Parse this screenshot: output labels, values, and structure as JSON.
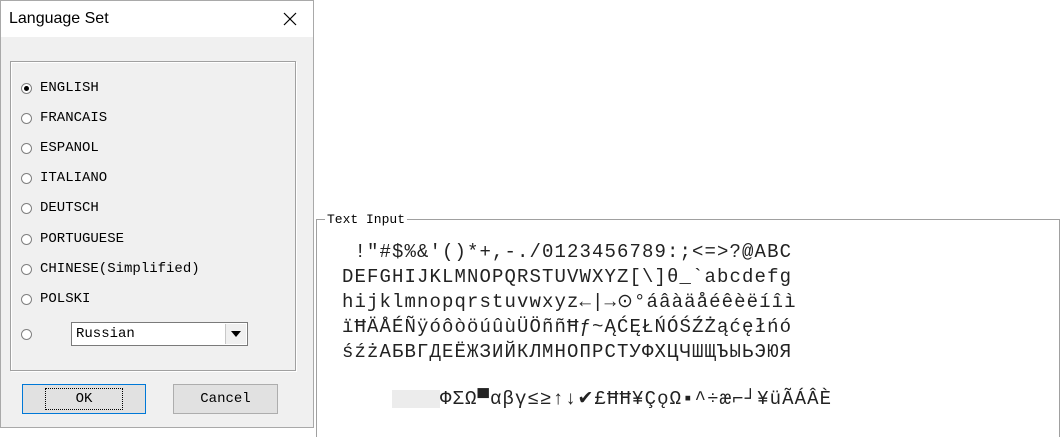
{
  "dialog": {
    "title": "Language Set",
    "languages": [
      {
        "label": "ENGLISH",
        "checked": true
      },
      {
        "label": "FRANCAIS",
        "checked": false
      },
      {
        "label": "ESPANOL",
        "checked": false
      },
      {
        "label": "ITALIANO",
        "checked": false
      },
      {
        "label": "DEUTSCH",
        "checked": false
      },
      {
        "label": "PORTUGUESE",
        "checked": false
      },
      {
        "label": "CHINESE(Simplified)",
        "checked": false
      },
      {
        "label": "POLSKI",
        "checked": false
      }
    ],
    "extra_language_value": "Russian",
    "ok_label": "OK",
    "cancel_label": "Cancel"
  },
  "text_input": {
    "legend": "Text Input",
    "rows": [
      " !\"#$%&'()*+,-./0123456789:;<=>?@ABC",
      "DEFGHIJKLMNOPQRSTUVWXYZ[\\]θ_`abcdefg",
      "hijklmnopqrstuvwxyz←|→⊙°áâàäåéêèëíîì",
      "ïĦÄÅÉÑÿóôòöúûùÜÖññĦƒ~ĄĆĘŁŃÓŚŹŻąćęłńó",
      "śźżАБВГДЕЁЖЗИЙКЛМНОПРСТУФХЦЧШЩЪЫЬЭЮЯ",
      "ФΣΩ▀αβγ≤≥↑↓✔£ĦĦ¥ÇǫΩ▪^÷æ⌐┘¥üÃÁÂÈ"
    ]
  }
}
